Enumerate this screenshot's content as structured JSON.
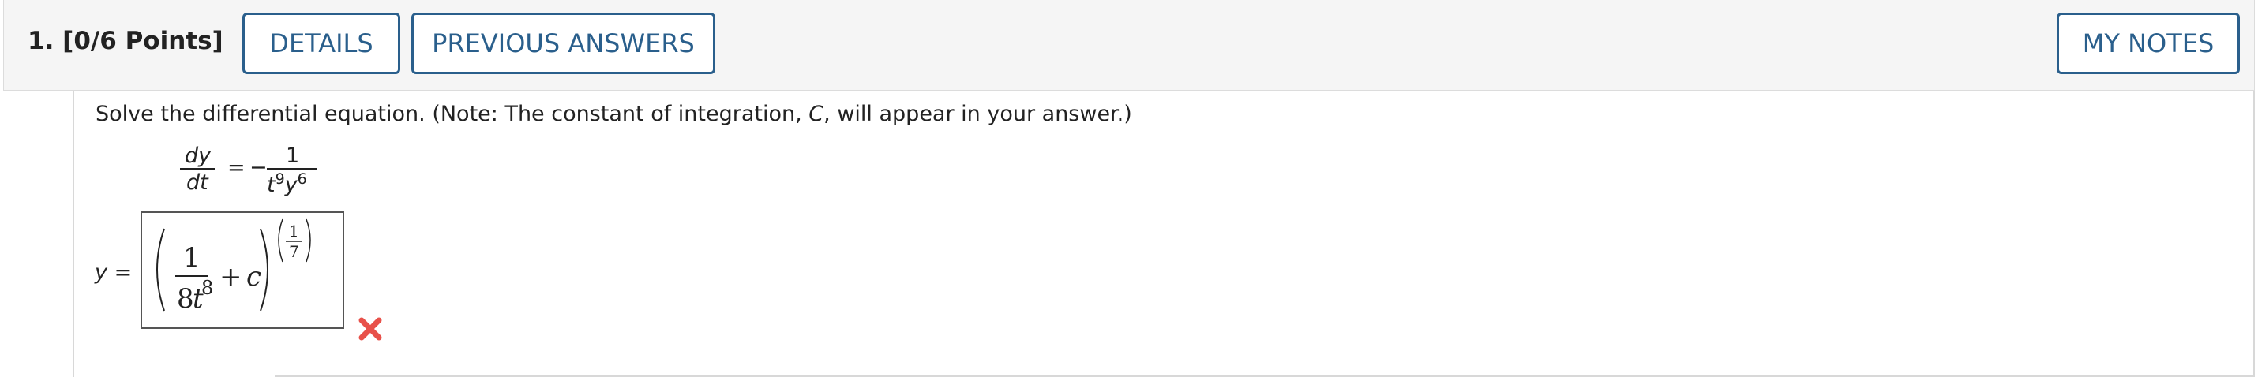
{
  "header": {
    "question_number": "1.",
    "points": "[0/6 Points]",
    "details_label": "DETAILS",
    "previous_answers_label": "PREVIOUS ANSWERS",
    "my_notes_label": "MY NOTES"
  },
  "question": {
    "prompt_start": "Solve the differential equation. (Note: The constant of integration, ",
    "prompt_var": "C",
    "prompt_end": ", will appear in your answer.)",
    "equation": {
      "lhs_num": "dy",
      "lhs_den": "dt",
      "equals": "=",
      "minus": "−",
      "rhs_num": "1",
      "rhs_den_base1": "t",
      "rhs_den_exp1": "9",
      "rhs_den_base2": "y",
      "rhs_den_exp2": "6"
    },
    "answer_label": "y =",
    "answer": {
      "inner_num": "1",
      "inner_den_coeff": "8",
      "inner_den_var": "t",
      "inner_den_exp": "8",
      "plus": "+",
      "constant": "c",
      "outer_exp_num": "1",
      "outer_exp_den": "7"
    },
    "status_icon": "incorrect-x-icon",
    "status_color": "#e8514a"
  }
}
